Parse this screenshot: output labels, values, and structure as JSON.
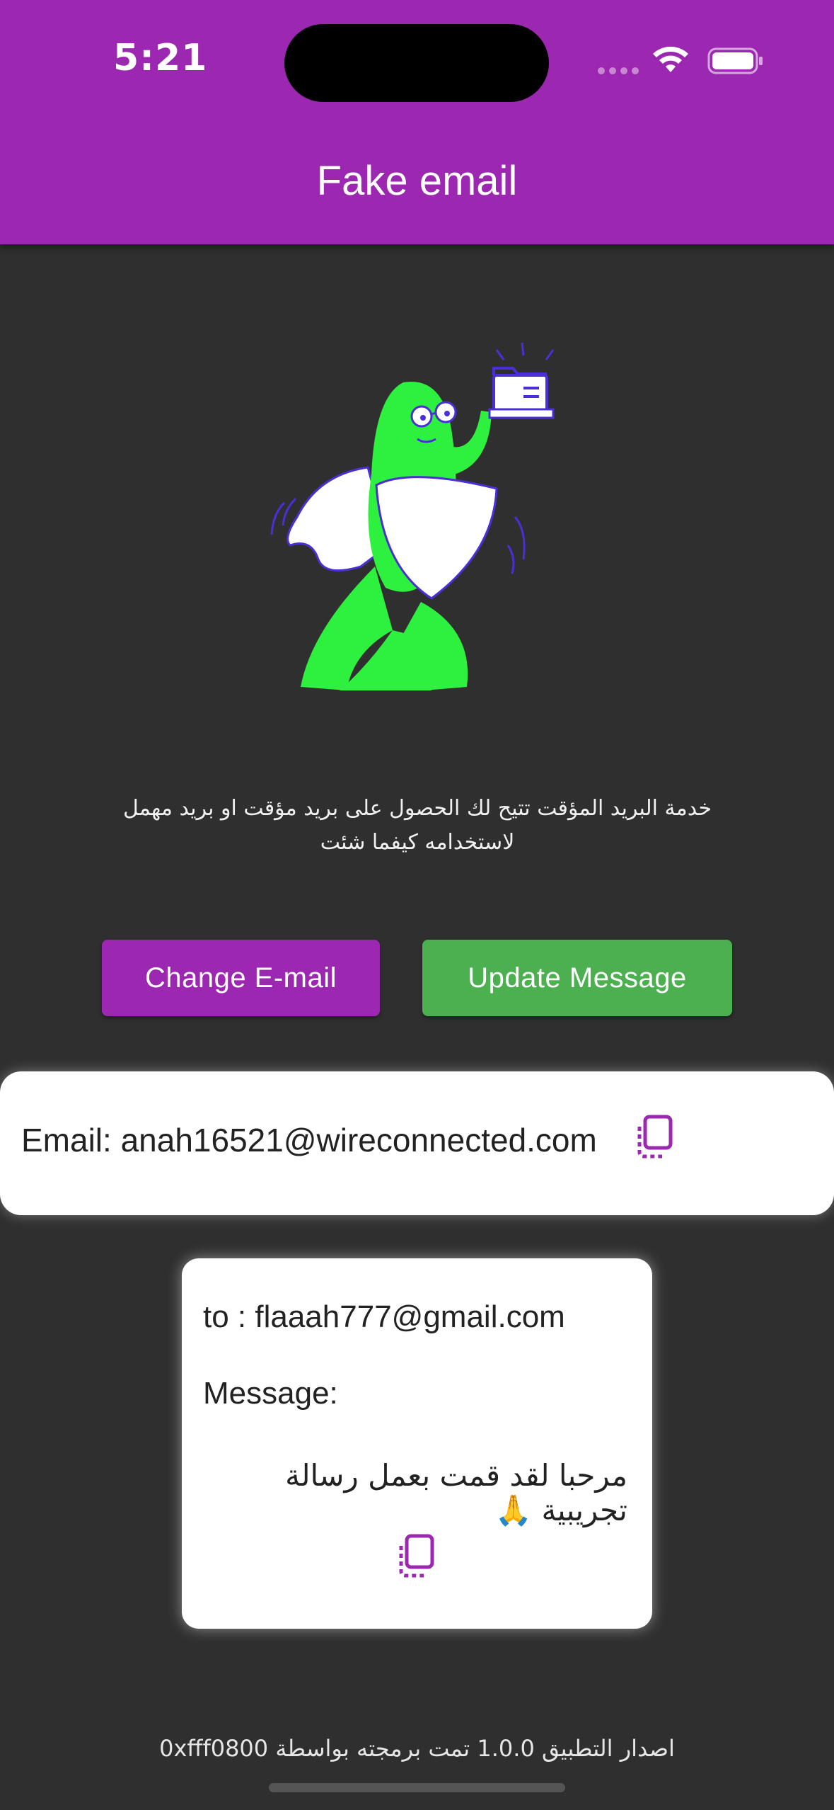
{
  "status_bar": {
    "time": "5:21"
  },
  "app_bar": {
    "title": "Fake email"
  },
  "hero": {
    "illustration": "green-mascot-with-shield-and-cape-holding-folder"
  },
  "description": "خدمة البريد المؤقت تتيح لك الحصول على بريد مؤقت او بريد مهمل لاستخدامه كيفما شئت",
  "buttons": {
    "change_email": "Change E-mail",
    "update_message": "Update Message"
  },
  "email_card": {
    "text": "Email: anah16521@wireconnected.com",
    "copy_icon": "copy-icon"
  },
  "message_card": {
    "to": "to : flaaah777@gmail.com",
    "label": "Message:",
    "body": "مرحبا لقد قمت بعمل رسالة تجريبية 🙏",
    "copy_icon": "copy-icon"
  },
  "footer": "اصدار التطبيق 1.0.0 تمت برمجته بواسطة 0xfff0800",
  "colors": {
    "primary": "#9c27b0",
    "success": "#4caf50",
    "background": "#2f2f2f",
    "mascot": "#2ef03f"
  }
}
